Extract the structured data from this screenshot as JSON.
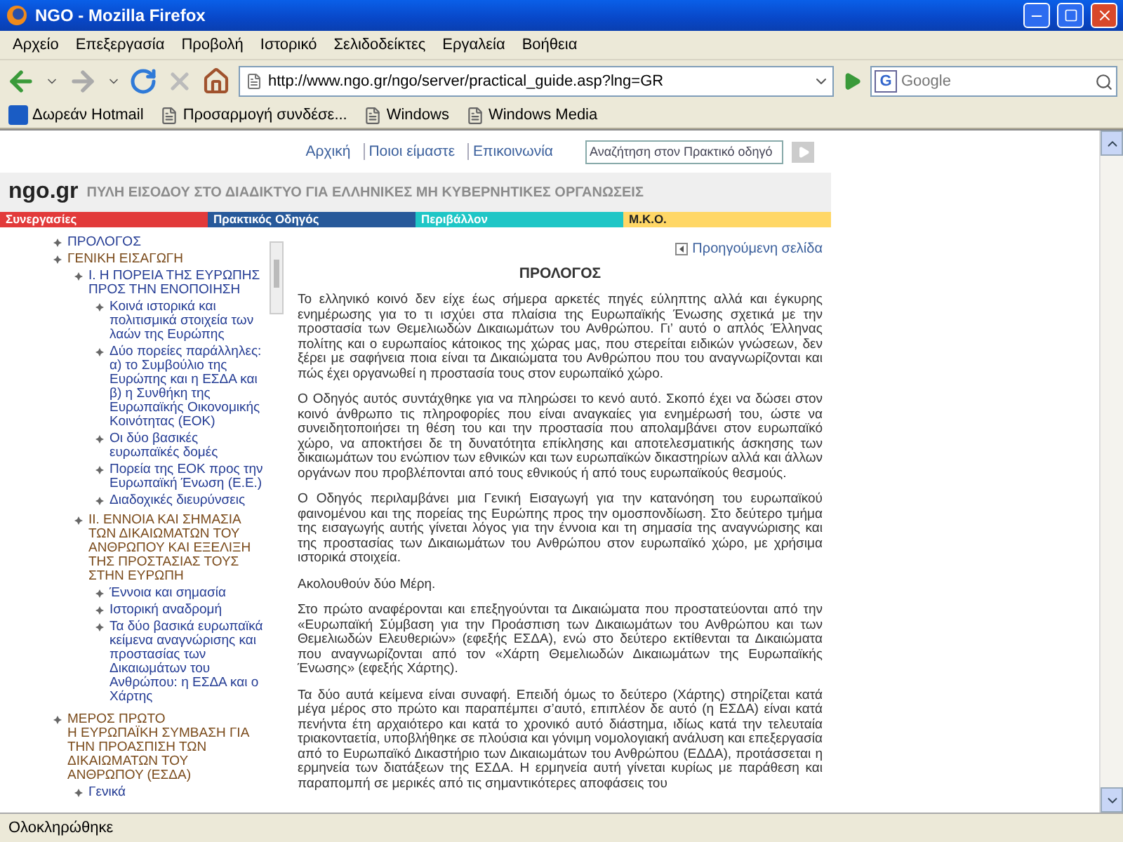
{
  "window": {
    "title": "NGO - Mozilla Firefox"
  },
  "menu": [
    "Αρχείο",
    "Επεξεργασία",
    "Προβολή",
    "Ιστορικό",
    "Σελιδοδείκτες",
    "Εργαλεία",
    "Βοήθεια"
  ],
  "address": {
    "value": "http://www.ngo.gr/ngo/server/practical_guide.asp?lng=GR"
  },
  "web_search": {
    "engine_mark": "G",
    "placeholder": "Google"
  },
  "bookmarks": [
    {
      "label": "Δωρεάν Hotmail",
      "kind": "site"
    },
    {
      "label": "Προσαρμογή συνδέσε...",
      "kind": "page"
    },
    {
      "label": "Windows",
      "kind": "page"
    },
    {
      "label": "Windows Media",
      "kind": "page"
    }
  ],
  "site": {
    "top_links": [
      "Αρχική",
      "Ποιοι είμαστε",
      "Επικοινωνία"
    ],
    "search": {
      "placeholder": "Αναζήτηση στον Πρακτικό οδηγό"
    },
    "logo": "ngo.gr",
    "tagline": "ΠΥΛΗ ΕΙΣΟΔΟΥ ΣΤΟ ΔΙΑΔΙΚΤΥΟ ΓΙΑ ΕΛΛΗΝΙΚΕΣ ΜΗ ΚΥΒΕΡΝΗΤΙΚΕΣ ΟΡΓΑΝΩΣΕΙΣ",
    "sections": [
      {
        "label": "Συνεργασίες",
        "color": "#e23a3a"
      },
      {
        "label": "Πρακτικός Οδηγός",
        "color": "#27599a"
      },
      {
        "label": "Περιβάλλον",
        "color": "#1fc6c6"
      },
      {
        "label": "Μ.Κ.Ο.",
        "color": "#ffd766"
      }
    ]
  },
  "toc": [
    {
      "label": "ΠΡΟΛΟΓΟΣ",
      "kind": "link"
    },
    {
      "label": "ΓΕΝΙΚΗ ΕΙΣΑΓΩΓΗ",
      "kind": "heading",
      "children": [
        {
          "label": "I. Η ΠΟΡΕΙΑ ΤΗΣ ΕΥΡΩΠΗΣ ΠΡΟΣ ΤΗΝ ΕΝΟΠΟΙΗΣΗ",
          "kind": "link",
          "children": [
            {
              "label": "Κοινά ιστορικά και πολιτισμικά στοιχεία των λαών της Ευρώπης",
              "kind": "link"
            },
            {
              "label": "Δύο πορείες παράλληλες: α) το Συμβούλιο της Ευρώπης και η ΕΣΔΑ και β) η Συνθήκη της Ευρωπαϊκής Οικονομικής Κοινότητας (ΕΟΚ)",
              "kind": "link"
            },
            {
              "label": "Οι δύο βασικές ευρωπαϊκές δομές",
              "kind": "link"
            },
            {
              "label": "Πορεία της ΕΟΚ προς την Ευρωπαϊκή Ένωση (Ε.Ε.)",
              "kind": "link"
            },
            {
              "label": "Διαδοχικές διευρύνσεις",
              "kind": "link"
            }
          ]
        },
        {
          "label": "II. ΕΝΝΟΙΑ ΚΑΙ ΣΗΜΑΣΙΑ ΤΩΝ ΔΙΚΑΙΩΜΑΤΩΝ ΤΟΥ ΑΝΘΡΩΠΟΥ ΚΑΙ ΕΞΕΛΙΞΗ ΤΗΣ ΠΡΟΣΤΑΣΙΑΣ ΤΟΥΣ ΣΤΗΝ ΕΥΡΩΠΗ",
          "kind": "heading",
          "children": [
            {
              "label": "Έννοια και σημασία",
              "kind": "link"
            },
            {
              "label": "Ιστορική αναδρομή",
              "kind": "link"
            },
            {
              "label": "Τα δύο βασικά ευρωπαϊκά κείμενα αναγνώρισης και προστασίας των Δικαιωμάτων του Ανθρώπου: η ΕΣΔΑ και ο Χάρτης",
              "kind": "link"
            }
          ]
        }
      ]
    },
    {
      "label": "ΜΕΡΟΣ ΠΡΩΤΟ\nΗ ΕΥΡΩΠΑΪΚΗ ΣΥΜΒΑΣΗ ΓΙΑ ΤΗΝ ΠΡΟΑΣΠΙΣΗ ΤΩΝ ΔΙΚΑΙΩΜΑΤΩΝ ΤΟΥ ΑΝΘΡΩΠΟΥ (ΕΣΔΑ)",
      "kind": "heading",
      "children": [
        {
          "label": "Γενικά",
          "kind": "link"
        }
      ]
    }
  ],
  "article": {
    "back_link": "Προηγούμενη σελίδα",
    "title": "ΠΡΟΛΟΓΟΣ",
    "paragraphs": [
      "Το ελληνικό κοινό δεν είχε έως σήμερα αρκετές πηγές εύληπτης αλλά και έγκυρης ενημέρωσης για το τι ισχύει στα πλαίσια της Ευρωπαϊκής Ένωσης σχετικά με την προστασία των Θεμελιωδών Δικαιωμάτων του Ανθρώπου. Γι’ αυτό ο απλός Έλληνας πολίτης και ο ευρωπαίος κάτοικος της χώρας μας, που στερείται ειδικών γνώσεων, δεν ξέρει με σαφήνεια ποια είναι τα Δικαιώματα του Ανθρώπου που του αναγνωρίζονται και πώς έχει οργανωθεί η προστασία τους στον ευρωπαϊκό χώρο.",
      "Ο Οδηγός αυτός συντάχθηκε για να πληρώσει το κενό αυτό. Σκοπό έχει να δώσει στον κοινό άνθρωπο τις πληροφορίες που είναι αναγκαίες για ενημέρωσή του, ώστε να συνειδητοποιήσει τη θέση του και την προστασία που απολαμβάνει στον ευρωπαϊκό χώρο, να αποκτήσει δε τη δυνατότητα επίκλησης και αποτελεσματικής άσκησης των δικαιωμάτων του ενώπιον των εθνικών και των ευρωπαϊκών δικαστηρίων αλλά και άλλων οργάνων που προβλέπονται από τους εθνικούς ή από τους ευρωπαϊκούς θεσμούς.",
      "Ο Οδηγός περιλαμβάνει μια Γενική Εισαγωγή για την κατανόηση του ευρωπαϊκού φαινομένου και της πορείας της Ευρώπης προς την ομοσπονδίωση. Στο δεύτερο τμήμα της εισαγωγής αυτής γίνεται λόγος για την έννοια και τη σημασία της αναγνώρισης και της προστασίας των Δικαιωμάτων του Ανθρώπου στον ευρωπαϊκό χώρο, με χρήσιμα ιστορικά στοιχεία.",
      "Ακολουθούν δύο Μέρη.",
      "Στο πρώτο αναφέρονται και επεξηγούνται τα Δικαιώματα που προστατεύονται από την «Ευρωπαϊκή Σύμβαση για την Προάσπιση των Δικαιωμάτων του Ανθρώπου και των Θεμελιωδών Ελευθεριών» (εφεξής ΕΣΔΑ), ενώ στο δεύτερο εκτίθενται τα Δικαιώματα που αναγνωρίζονται από τον «Χάρτη Θεμελιωδών Δικαιωμάτων της Ευρωπαϊκής Ένωσης» (εφεξής Χάρτης).",
      "Τα δύο αυτά κείμενα είναι συναφή. Επειδή όμως το δεύτερο (Χάρτης) στηρίζεται κατά μέγα μέρος στο πρώτο και παραπέμπει σ’αυτό, επιπλέον δε αυτό (η ΕΣΔΑ) είναι κατά πενήντα έτη αρχαιότερο και κατά το χρονικό αυτό διάστημα, ιδίως κατά την τελευταία τριακονταετία, υποβλήθηκε σε πλούσια και γόνιμη νομολογιακή ανάλυση και επεξεργασία από το Ευρωπαϊκό Δικαστήριο των Δικαιωμάτων του Ανθρώπου (ΕΔΔΑ), προτάσσεται η ερμηνεία των διατάξεων της ΕΣΔΑ. Η ερμηνεία αυτή γίνεται κυρίως με παράθεση και παραπομπή σε μερικές από τις σημαντικότερες αποφάσεις του"
    ]
  },
  "status_bar": "Ολοκληρώθηκε"
}
